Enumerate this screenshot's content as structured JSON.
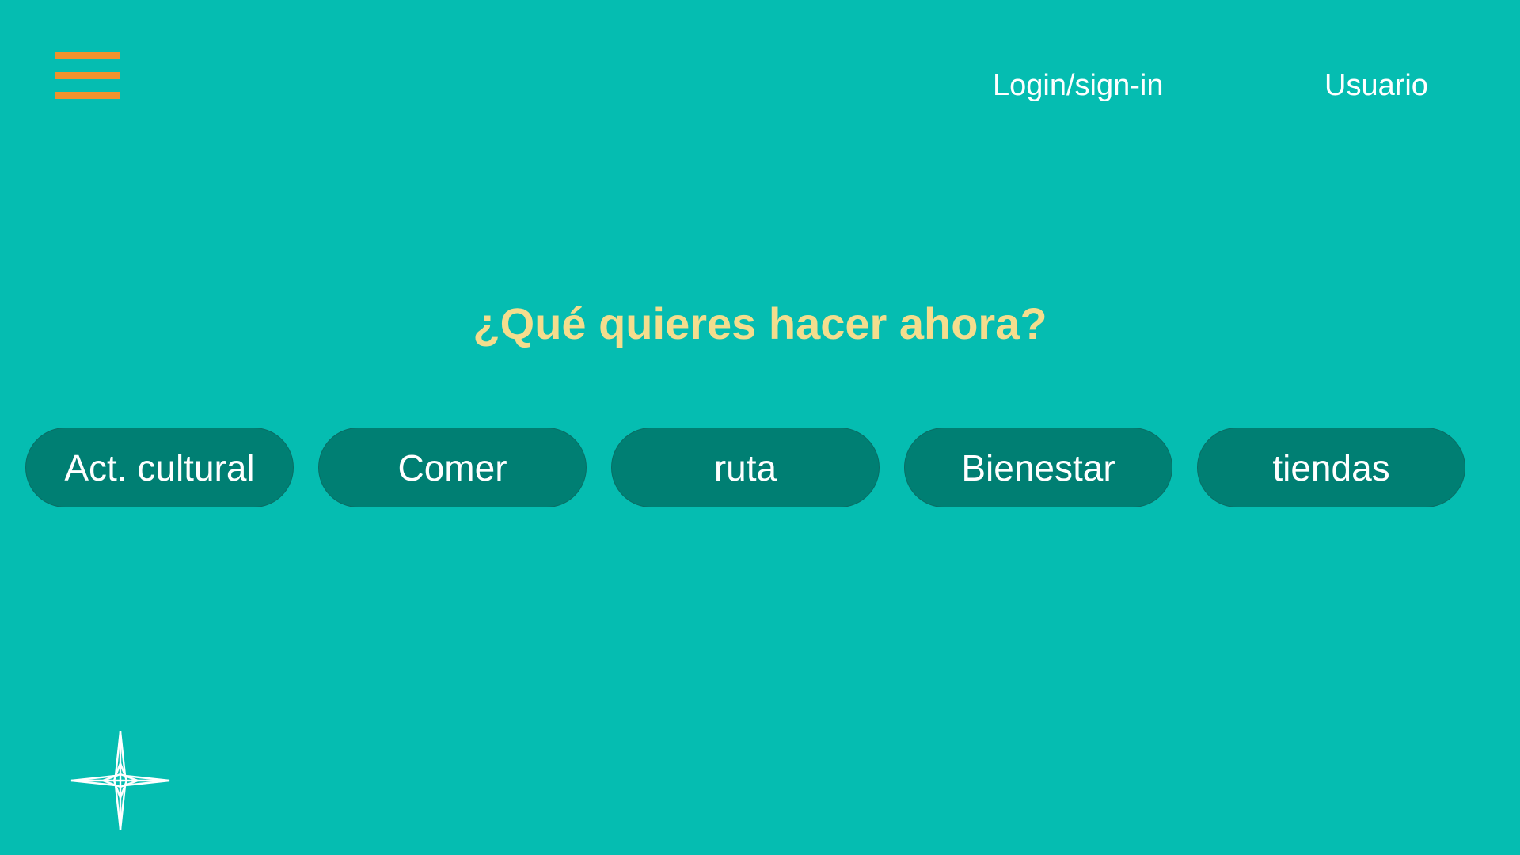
{
  "header": {
    "menu_icon": "hamburger-menu-icon",
    "login_label": "Login/sign-in",
    "user_label": "Usuario"
  },
  "main": {
    "question": "¿Qué quieres hacer ahora?",
    "options": [
      {
        "label": "Act. cultural"
      },
      {
        "label": "Comer"
      },
      {
        "label": "ruta"
      },
      {
        "label": "Bienestar"
      },
      {
        "label": "tiendas"
      }
    ]
  },
  "footer": {
    "logo_icon": "compass-star-icon"
  },
  "colors": {
    "background": "#05bdb1",
    "menu_accent": "#f0922d",
    "headline": "#f4dd8d",
    "button": "#007f73",
    "text_light": "#ffffff"
  }
}
